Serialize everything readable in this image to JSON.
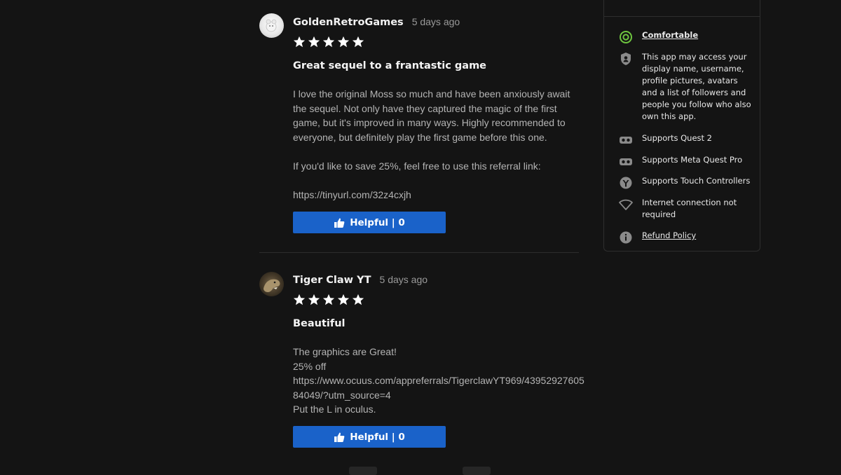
{
  "reviews": [
    {
      "author": "GoldenRetroGames",
      "date": "5 days ago",
      "rating": 5,
      "title": "Great sequel to a frantastic game",
      "paragraphs": [
        "I love the original Moss so much and have been anxiously await the sequel. Not only have they captured the magic of the first game, but it's improved in many ways. Highly recommended to everyone, but definitely play the first game before this one.",
        "If you'd like to save 25%, feel free to use this referral link:",
        "https://tinyurl.com/32z4cxjh"
      ],
      "helpful_label": "Helpful | 0"
    },
    {
      "author": "Tiger Claw YT",
      "date": "5 days ago",
      "rating": 5,
      "title": "Beautiful",
      "lines": [
        "The graphics are Great!",
        "25% off",
        "https://www.ocuus.com/appreferrals/TigerclawYT969/43952927605",
        "84049/?utm_source=4",
        "Put the L in oculus."
      ],
      "helpful_label": "Helpful | 0"
    }
  ],
  "sidebar": {
    "comfort": "Comfortable",
    "permissions": "This app may access your display name, username, profile pictures, avatars and a list of followers and people you follow who also own this app.",
    "supports_quest2": "Supports Quest 2",
    "supports_quest_pro": "Supports Meta Quest Pro",
    "supports_touch": "Supports Touch Controllers",
    "internet": "Internet connection not required",
    "refund": "Refund Policy"
  },
  "icons": {
    "comfort": "comfortable-ring-icon",
    "permissions": "shield-icon",
    "headset": "vr-headset-icon",
    "controller": "touch-controller-icon",
    "wifi": "wifi-off-icon",
    "info": "info-icon",
    "thumb": "thumbs-up-icon",
    "star": "star-icon"
  },
  "colors": {
    "background": "#141414",
    "accent_button": "#1a62c9",
    "comfort_green": "#6ec63f",
    "muted_text": "#b4b4b4"
  }
}
